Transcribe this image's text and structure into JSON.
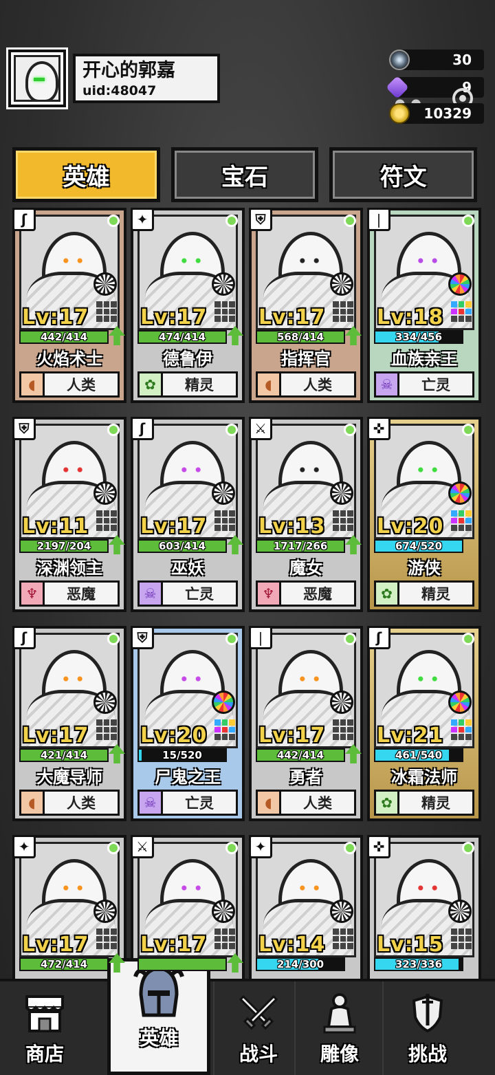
{
  "player": {
    "name": "开心的郭嘉",
    "uid": "uid:48047"
  },
  "resources": {
    "crystal": "30",
    "gem": "9",
    "gold": "10329"
  },
  "tabs": [
    {
      "label": "英雄",
      "active": true
    },
    {
      "label": "宝石",
      "active": false
    },
    {
      "label": "符文",
      "active": false
    }
  ],
  "heroes": [
    {
      "name": "火焰术士",
      "level": "Lv:17",
      "xp": "442/414",
      "xp_fraction": 1.0,
      "race": "人类",
      "race_type": "human",
      "class_icon": "staff-icon",
      "card": "c-human",
      "upgradable": true,
      "rare": false,
      "eye": "#f7931e"
    },
    {
      "name": "德鲁伊",
      "level": "Lv:17",
      "xp": "474/414",
      "xp_fraction": 1.0,
      "race": "精灵",
      "race_type": "elf",
      "class_icon": "star-icon",
      "card": "c-gray",
      "upgradable": true,
      "rare": false,
      "eye": "#3fdc3f"
    },
    {
      "name": "指挥官",
      "level": "Lv:17",
      "xp": "568/414",
      "xp_fraction": 1.0,
      "race": "人类",
      "race_type": "human",
      "class_icon": "shield-icon",
      "card": "c-human",
      "upgradable": true,
      "rare": false,
      "eye": "#222222"
    },
    {
      "name": "血族亲王",
      "level": "Lv:18",
      "xp": "334/456",
      "xp_fraction": 0.73,
      "race": "亡灵",
      "race_type": "undead",
      "class_icon": "dagger-icon",
      "card": "c-undead",
      "upgradable": false,
      "rare": true,
      "eye": "#b84ae8"
    },
    {
      "name": "深渊领主",
      "level": "Lv:11",
      "xp": "2197/204",
      "xp_fraction": 1.0,
      "race": "恶魔",
      "race_type": "demon",
      "class_icon": "shield-icon",
      "card": "c-gray",
      "upgradable": true,
      "rare": false,
      "eye": "#e33333"
    },
    {
      "name": "巫妖",
      "level": "Lv:17",
      "xp": "603/414",
      "xp_fraction": 1.0,
      "race": "亡灵",
      "race_type": "undead",
      "class_icon": "staff-icon",
      "card": "c-gray",
      "upgradable": true,
      "rare": false,
      "eye": "#c64ae8"
    },
    {
      "name": "魔女",
      "level": "Lv:13",
      "xp": "1717/266",
      "xp_fraction": 1.0,
      "race": "恶魔",
      "race_type": "demon",
      "class_icon": "sword-icon",
      "card": "c-gray",
      "upgradable": true,
      "rare": false,
      "eye": "#222222"
    },
    {
      "name": "游侠",
      "level": "Lv:20",
      "xp": "674/520",
      "xp_fraction": 1.0,
      "race": "精灵",
      "race_type": "elf",
      "class_icon": "bow-icon",
      "card": "c-gold",
      "upgradable": false,
      "rare": true,
      "eye": "#3fdc3f"
    },
    {
      "name": "大魔导师",
      "level": "Lv:17",
      "xp": "421/414",
      "xp_fraction": 1.0,
      "race": "人类",
      "race_type": "human",
      "class_icon": "staff-icon",
      "card": "c-gray",
      "upgradable": true,
      "rare": false,
      "eye": "#f7931e"
    },
    {
      "name": "尸鬼之王",
      "level": "Lv:20",
      "xp": "15/520",
      "xp_fraction": 0.03,
      "race": "亡灵",
      "race_type": "undead",
      "class_icon": "shield-icon",
      "card": "c-blue",
      "upgradable": false,
      "rare": true,
      "eye": "#c64ae8"
    },
    {
      "name": "勇者",
      "level": "Lv:17",
      "xp": "442/414",
      "xp_fraction": 1.0,
      "race": "人类",
      "race_type": "human",
      "class_icon": "dagger-icon",
      "card": "c-gray",
      "upgradable": true,
      "rare": false,
      "eye": "#f7931e"
    },
    {
      "name": "冰霜法师",
      "level": "Lv:21",
      "xp": "461/540",
      "xp_fraction": 0.85,
      "race": "精灵",
      "race_type": "elf",
      "class_icon": "staff-icon",
      "card": "c-gold",
      "upgradable": false,
      "rare": true,
      "eye": "#3fdc3f"
    },
    {
      "name": "",
      "level": "Lv:17",
      "xp": "472/414",
      "xp_fraction": 1.0,
      "race": "",
      "race_type": "human",
      "class_icon": "star-icon",
      "card": "c-gray",
      "upgradable": true,
      "rare": false,
      "eye": "#f7931e"
    },
    {
      "name": "",
      "level": "Lv:17",
      "xp": "",
      "xp_fraction": 1.0,
      "race": "",
      "race_type": "undead",
      "class_icon": "sword-icon",
      "card": "c-gray",
      "upgradable": true,
      "rare": false,
      "eye": "#c64ae8"
    },
    {
      "name": "",
      "level": "Lv:14",
      "xp": "214/300",
      "xp_fraction": 0.71,
      "race": "",
      "race_type": "human",
      "class_icon": "star-icon",
      "card": "c-gray",
      "upgradable": false,
      "rare": false,
      "eye": "#f7931e"
    },
    {
      "name": "",
      "level": "Lv:15",
      "xp": "323/336",
      "xp_fraction": 0.96,
      "race": "",
      "race_type": "demon",
      "class_icon": "bow-icon",
      "card": "c-gray",
      "upgradable": false,
      "rare": false,
      "eye": "#e33333"
    }
  ],
  "nav": [
    {
      "label": "商店",
      "icon": "shop-icon"
    },
    {
      "label": "英雄",
      "icon": "helmet-icon",
      "active": true
    },
    {
      "label": "战斗",
      "icon": "crossed-swords-icon"
    },
    {
      "label": "雕像",
      "icon": "statue-icon"
    },
    {
      "label": "挑战",
      "icon": "shield-sword-icon"
    }
  ]
}
